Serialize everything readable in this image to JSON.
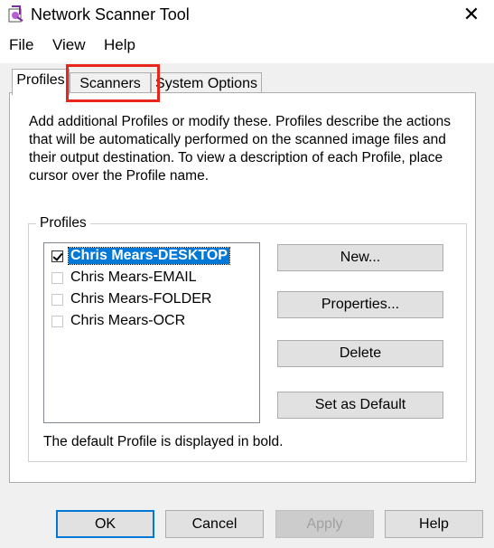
{
  "window": {
    "title": "Network Scanner Tool"
  },
  "menu": [
    "File",
    "View",
    "Help"
  ],
  "tabs": [
    {
      "label": "Profiles",
      "active": true
    },
    {
      "label": "Scanners",
      "active": false,
      "highlighted": true
    },
    {
      "label": "System Options",
      "active": false
    }
  ],
  "description": "Add additional Profiles or modify these. Profiles describe the actions that will be automatically performed on the scanned image files and their output destination. To view a description of each  Profile, place cursor over the Profile name.",
  "profiles_group": {
    "label": "Profiles",
    "items": [
      {
        "label": "Chris Mears-DESKTOP",
        "checked": true,
        "selected": true,
        "bold": true
      },
      {
        "label": "Chris Mears-EMAIL",
        "checked": false,
        "selected": false,
        "bold": false
      },
      {
        "label": "Chris Mears-FOLDER",
        "checked": false,
        "selected": false,
        "bold": false
      },
      {
        "label": "Chris Mears-OCR",
        "checked": false,
        "selected": false,
        "bold": false
      }
    ],
    "buttons": {
      "new": "New...",
      "properties": "Properties...",
      "delete": "Delete",
      "set_default": "Set as Default"
    },
    "note": "The default Profile is displayed in bold."
  },
  "dialog_buttons": {
    "ok": "OK",
    "cancel": "Cancel",
    "apply": "Apply",
    "help": "Help"
  },
  "colors": {
    "highlight": "#e8271c",
    "selection": "#0078d7",
    "dialog_bg": "#f0f0f0"
  },
  "icons": {
    "app": "scanner-app-icon",
    "close": "close-icon"
  }
}
